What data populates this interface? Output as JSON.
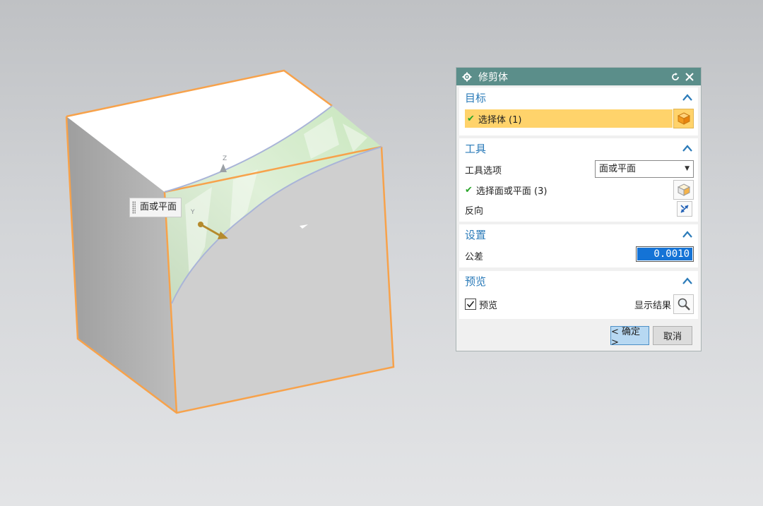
{
  "viewport": {
    "axis_label": "Z",
    "y_axis_label": "Y",
    "tooltip": "面或平面"
  },
  "dialog": {
    "title": "修剪体",
    "icons": {
      "settings": "gear-icon",
      "reset": "reset-icon",
      "close": "close-icon"
    },
    "target": {
      "header": "目标",
      "select_label": "选择体 (1)",
      "icon": "cube-icon"
    },
    "tool": {
      "header": "工具",
      "option_label": "工具选项",
      "option_value": "面或平面",
      "select_label": "选择面或平面 (3)",
      "reverse_label": "反向"
    },
    "settings": {
      "header": "设置",
      "tolerance_label": "公差",
      "tolerance_value": "0.0010"
    },
    "preview": {
      "header": "预览",
      "checkbox_label": "预览",
      "checked": true,
      "show_result_label": "显示结果"
    },
    "buttons": {
      "ok": "< 确定 >",
      "cancel": "取消"
    }
  },
  "colors": {
    "accent": "#5b8e8a",
    "header_text": "#2b7bb9",
    "selection_highlight": "#ffd36b",
    "edge_highlight": "#f7a24b"
  }
}
